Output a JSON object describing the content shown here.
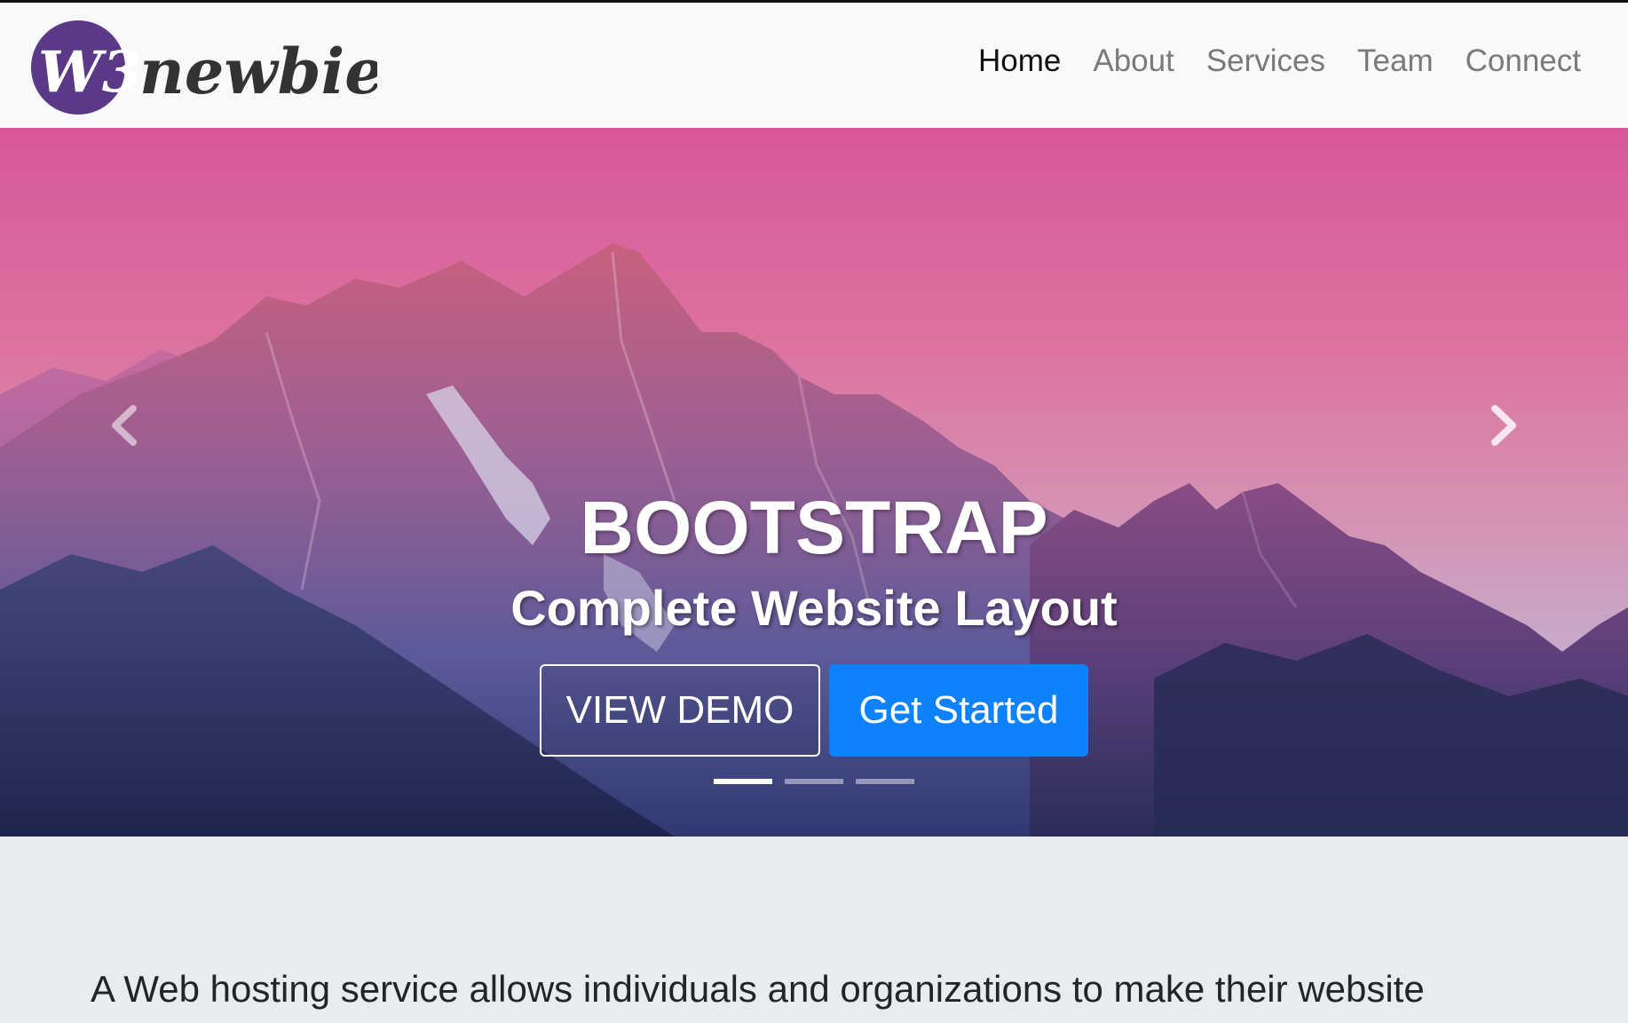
{
  "brand": {
    "logo_badge_text": "W3",
    "logo_word": "newbie",
    "badge_color": "#5a3a87",
    "word_color": "#333333"
  },
  "nav": {
    "items": [
      {
        "label": "Home",
        "active": true
      },
      {
        "label": "About",
        "active": false
      },
      {
        "label": "Services",
        "active": false
      },
      {
        "label": "Team",
        "active": false
      },
      {
        "label": "Connect",
        "active": false
      }
    ]
  },
  "carousel": {
    "title": "BOOTSTRAP",
    "subtitle": "Complete Website Layout",
    "buttons": {
      "view_demo": "VIEW DEMO",
      "get_started": "Get Started"
    },
    "prev_icon": "chevron-left-icon",
    "next_icon": "chevron-right-icon",
    "slide_count": 3,
    "active_slide": 1,
    "accent_color": "#0d82fb"
  },
  "jumbotron": {
    "lead": "A Web hosting service allows individuals and organizations to make their website"
  }
}
